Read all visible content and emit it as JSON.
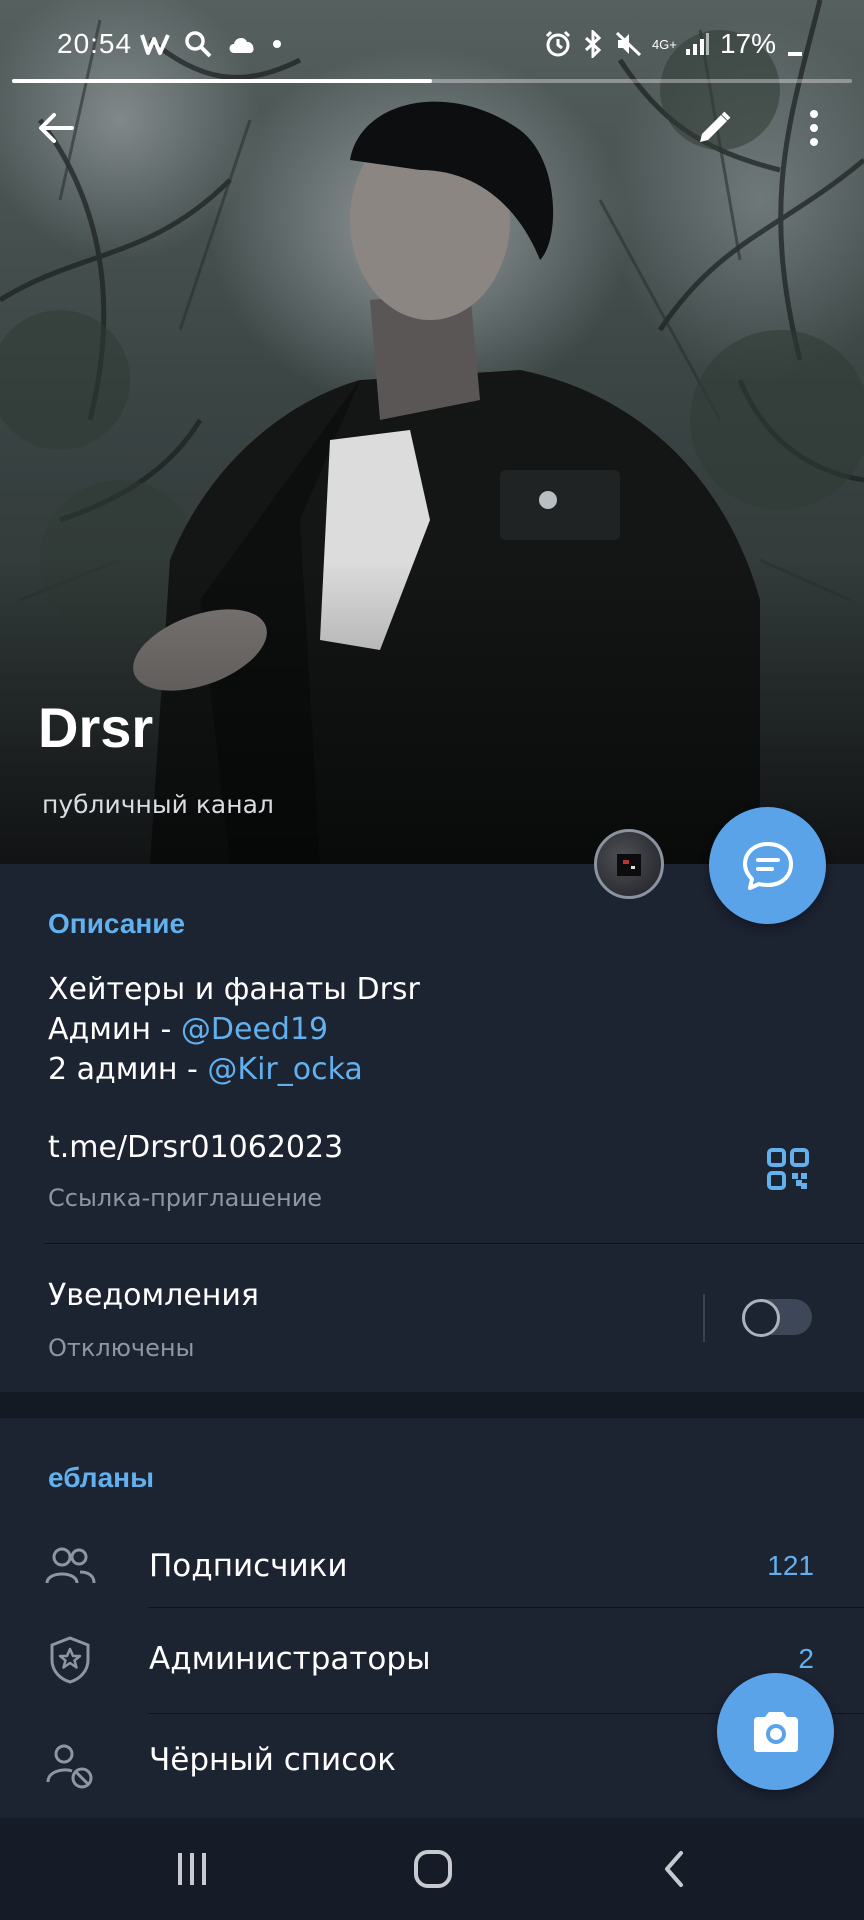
{
  "status_bar": {
    "time": "20:54",
    "battery": "17%",
    "network": "4G+"
  },
  "story_progress": 0.5,
  "profile": {
    "name": "Drsr",
    "subtitle": "публичный канал"
  },
  "description": {
    "title": "Описание",
    "line1": "Хейтеры и фанаты Drsr",
    "line2_prefix": "Админ - ",
    "line2_link": "@Deed19",
    "line3_prefix": "2 админ - ",
    "line3_link": "@Kir_ocka"
  },
  "invite": {
    "link": "t.me/Drsr01062023",
    "label": "Ссылка-приглашение"
  },
  "notifications": {
    "label": "Уведомления",
    "status": "Отключены",
    "enabled": false
  },
  "members_section": {
    "title": "ебланы",
    "items": [
      {
        "label": "Подписчики",
        "count": "121",
        "icon": "users-icon"
      },
      {
        "label": "Администраторы",
        "count": "2",
        "icon": "admin-shield-icon"
      },
      {
        "label": "Чёрный список",
        "count": "",
        "icon": "blocked-user-icon"
      }
    ]
  },
  "colors": {
    "accent": "#5aa3e8",
    "link": "#62b0ee",
    "background": "#1c2331"
  }
}
